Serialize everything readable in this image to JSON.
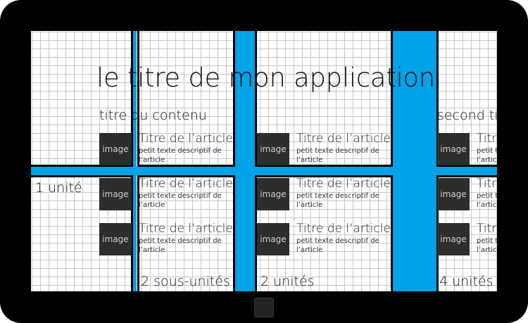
{
  "page": {
    "app_title": "le titre de mon application",
    "section_1_title": "titre du contenu",
    "section_2_title": "second titre"
  },
  "articles": {
    "thumb_label": "image",
    "title": "Titre de l’article",
    "desc": "petit texte descriptif de l’article"
  },
  "units": {
    "one": "1 unité",
    "two_sub": "2 sous-unités",
    "two": "2 unités",
    "four": "4 unités"
  },
  "colors": {
    "band": "#00a2e8",
    "thumb": "#2d2d2d",
    "bezel": "#000000"
  }
}
